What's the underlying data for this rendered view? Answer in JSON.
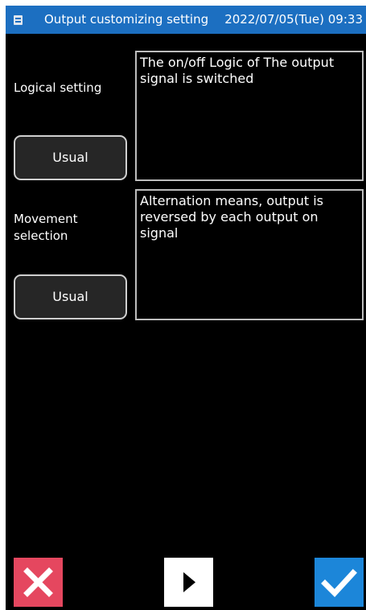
{
  "titlebar": {
    "title": "Output customizing setting",
    "datetime": "2022/07/05(Tue) 09:33"
  },
  "logical_setting": {
    "label": "Logical setting",
    "value": "Usual",
    "description": "The on/off Logic of The output signal is switched"
  },
  "movement_selection": {
    "label": "Movement selection",
    "value": "Usual",
    "description": "Alternation means, output is reversed by each output on signal"
  },
  "actions": {
    "cancel_icon": "close-icon",
    "next_icon": "play-icon",
    "ok_icon": "check-icon"
  },
  "colors": {
    "titlebar": "#1c6fc1",
    "cancel": "#e5475f",
    "ok": "#1c86d9",
    "background": "#000000"
  }
}
